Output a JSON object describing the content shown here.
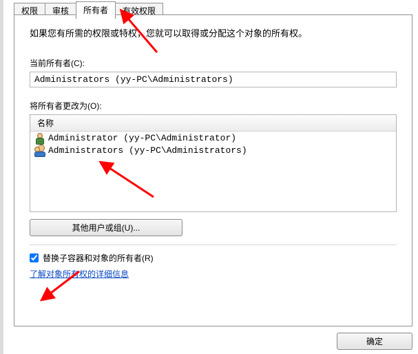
{
  "tabs": {
    "t0": "权限",
    "t1": "审核",
    "t2": "所有者",
    "t3": "有效权限"
  },
  "panel": {
    "intro": "如果您有所需的权限或特权，您就可以取得或分配这个对象的所有权。",
    "current_owner_label": "当前所有者(C):",
    "current_owner_value": "Administrators (yy-PC\\Administrators)",
    "change_to_label": "将所有者更改为(O):",
    "list_header": "名称",
    "owners": [
      {
        "type": "user",
        "name": "Administrator (yy-PC\\Administrator)"
      },
      {
        "type": "group",
        "name": "Administrators (yy-PC\\Administrators)"
      }
    ],
    "other_principal_btn": "其他用户或组(U)...",
    "replace_children_label": "替换子容器和对象的所有者(R)",
    "replace_children_checked": true,
    "learn_more_link": "了解对象所有权的详细信息"
  },
  "footer": {
    "ok": "确定"
  }
}
